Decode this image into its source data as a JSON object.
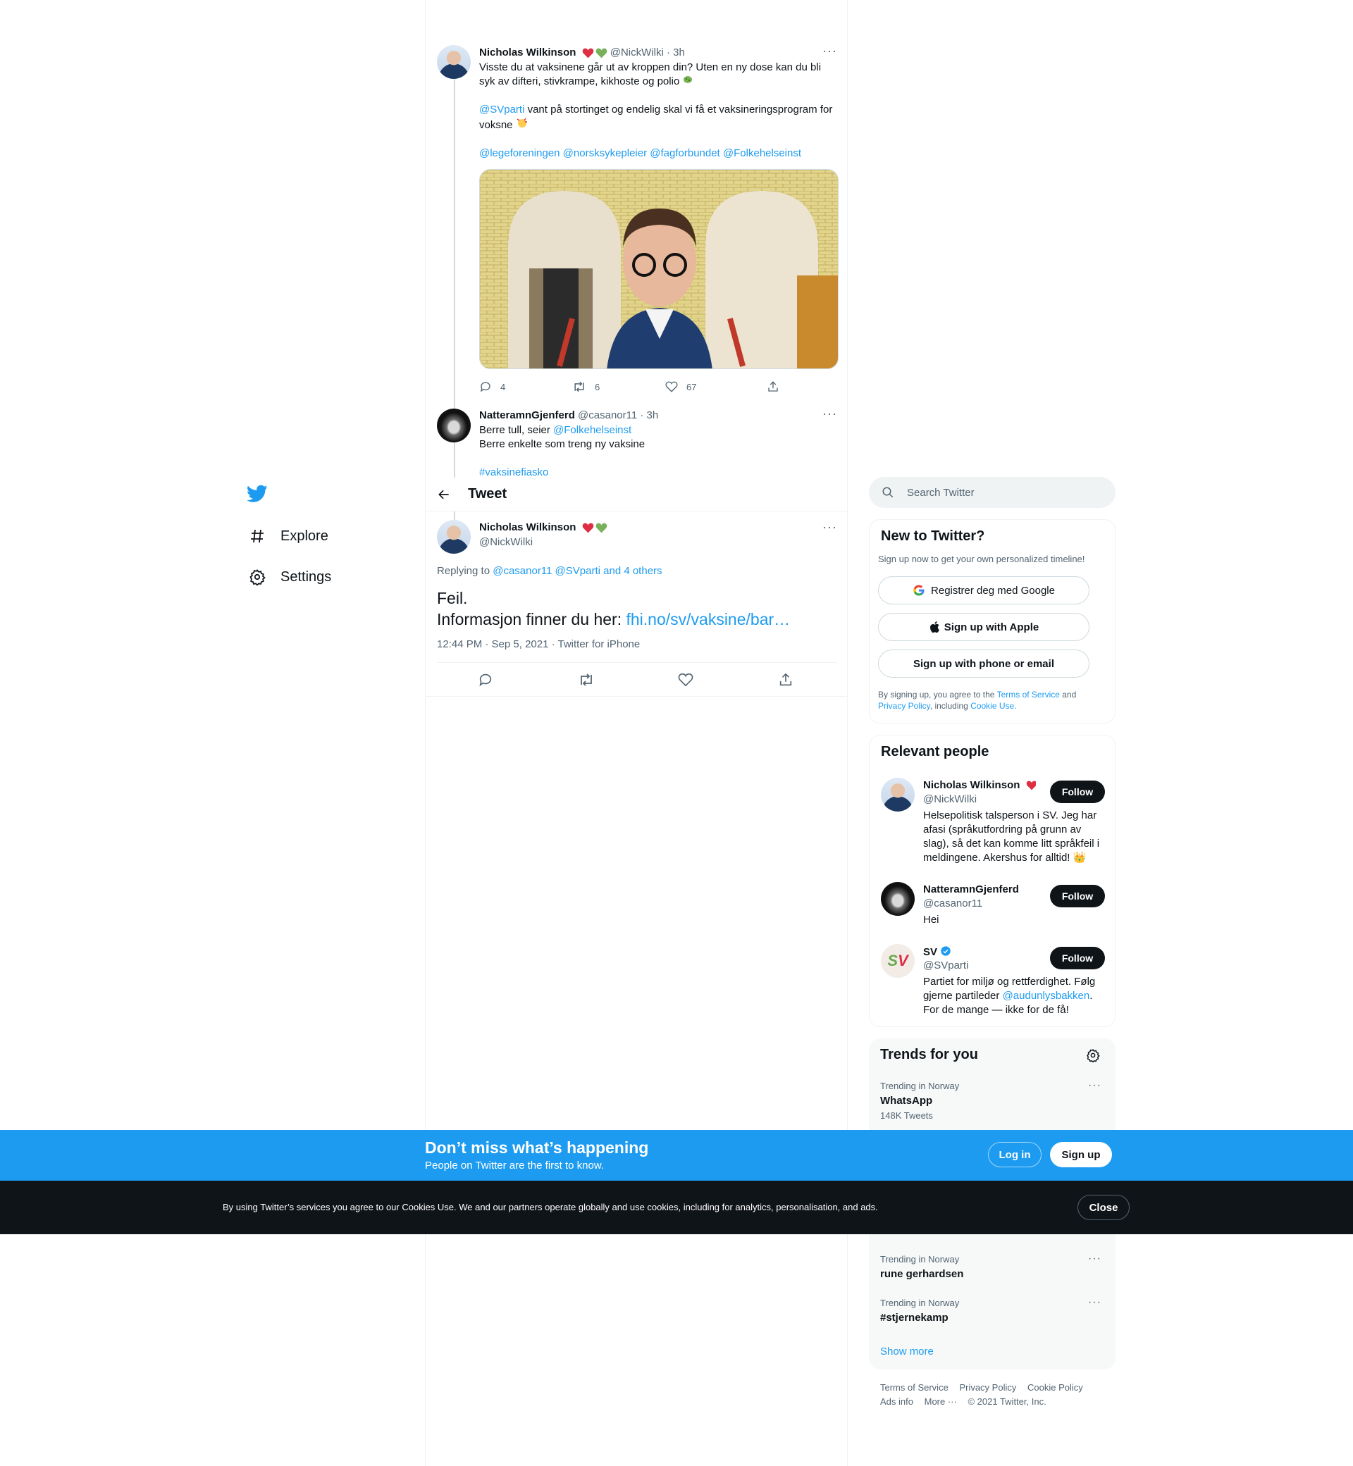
{
  "nav": {
    "items": [
      {
        "label": "Explore",
        "icon": "hashtag-icon"
      },
      {
        "label": "Settings",
        "icon": "gear-icon"
      }
    ]
  },
  "header": {
    "title": "Tweet"
  },
  "thread": {
    "tweet1": {
      "name": "Nicholas Wilkinson",
      "handle": "@NickWilki",
      "time": "· 3h",
      "text1": "Visste du at vaksinene går ut av kroppen din? Uten en ny dose kan du bli syk av difteri, stivkrampe, kikhoste og polio",
      "mention_sv": "@SVparti",
      "text2": " vant på stortinget og endelig skal vi få et vaksineringsprogram for voksne",
      "mentions": [
        "@legeforeningen",
        "@norsksykepleier",
        "@fagforbundet",
        "@Folkehelseinst"
      ],
      "replies": "4",
      "retweets": "6",
      "likes": "67"
    },
    "tweet2": {
      "name": "NatteramnGjenferd",
      "handle": "@casanor11",
      "time": "· 3h",
      "line1_prefix": "Berre tull, seier ",
      "line1_mention": "@Folkehelseinst",
      "line2": "Berre enkelte som treng ny vaksine",
      "hashtag": "#vaksinefiasko"
    }
  },
  "main_tweet": {
    "name": "Nicholas Wilkinson",
    "handle": "@NickWilki",
    "replying_prefix": "Replying to ",
    "replying_users": "@casanor11 @SVparti and 4 others",
    "line1": "Feil.",
    "line2_prefix": "Informasjon finner du her: ",
    "link": "fhi.no/sv/vaksine/bar…",
    "meta": "12:44 PM · Sep 5, 2021 · Twitter for iPhone"
  },
  "search": {
    "placeholder": "Search Twitter"
  },
  "new_to_twitter": {
    "title": "New to Twitter?",
    "subtitle": "Sign up now to get your own personalized timeline!",
    "google": "Registrer deg med Google",
    "apple": "Sign up with Apple",
    "email": "Sign up with phone or email",
    "legal_1": "By signing up, you agree to the ",
    "terms": "Terms of Service",
    "legal_2": " and",
    "privacy": "Privacy Policy",
    "legal_3": ", including ",
    "cookie": "Cookie Use."
  },
  "relevant_people": {
    "title": "Relevant people",
    "follow_label": "Follow",
    "people": [
      {
        "name": "Nicholas Wilkinson",
        "handle": "@NickWilki",
        "bio": "Helsepolitisk talsperson i SV. Jeg har afasi (språkutfordring på grunn av slag), så det kan komme litt språkfeil i meldingene. Akershus for alltid! 👑"
      },
      {
        "name": "NatteramnGjenferd",
        "handle": "@casanor11",
        "bio": "Hei"
      },
      {
        "name": "SV",
        "handle": "@SVparti",
        "bio_1": "Partiet for miljø og rettferdighet. Følg gjerne partileder ",
        "bio_mention": "@audunlysbakken",
        "bio_2": ". For de mange — ikke for de få!"
      }
    ]
  },
  "trends": {
    "title": "Trends for you",
    "items": [
      {
        "meta": "Trending in Norway",
        "name": "WhatsApp",
        "count": "148K Tweets"
      },
      {
        "meta": "Trending in Norway",
        "name": "rune gerhardsen",
        "count": ""
      },
      {
        "meta": "Trending in Norway",
        "name": "#stjernekamp",
        "count": ""
      }
    ],
    "show_more": "Show more"
  },
  "footer": {
    "links_row1": [
      "Terms of Service",
      "Privacy Policy",
      "Cookie Policy"
    ],
    "ads_info": "Ads info",
    "more": "More ···",
    "copyright": "© 2021 Twitter, Inc."
  },
  "bottom_bar": {
    "title": "Don’t miss what’s happening",
    "subtitle": "People on Twitter are the first to know.",
    "login": "Log in",
    "signup": "Sign up"
  },
  "cookie_bar": {
    "text": "By using Twitter’s services you agree to our Cookies Use. We and our partners operate globally and use cookies, including for analytics, personalisation, and ads.",
    "close": "Close"
  },
  "colors": {
    "accent": "#1d9bf0",
    "text": "#0f1419",
    "muted": "#536471",
    "dark": "#0f1419"
  }
}
